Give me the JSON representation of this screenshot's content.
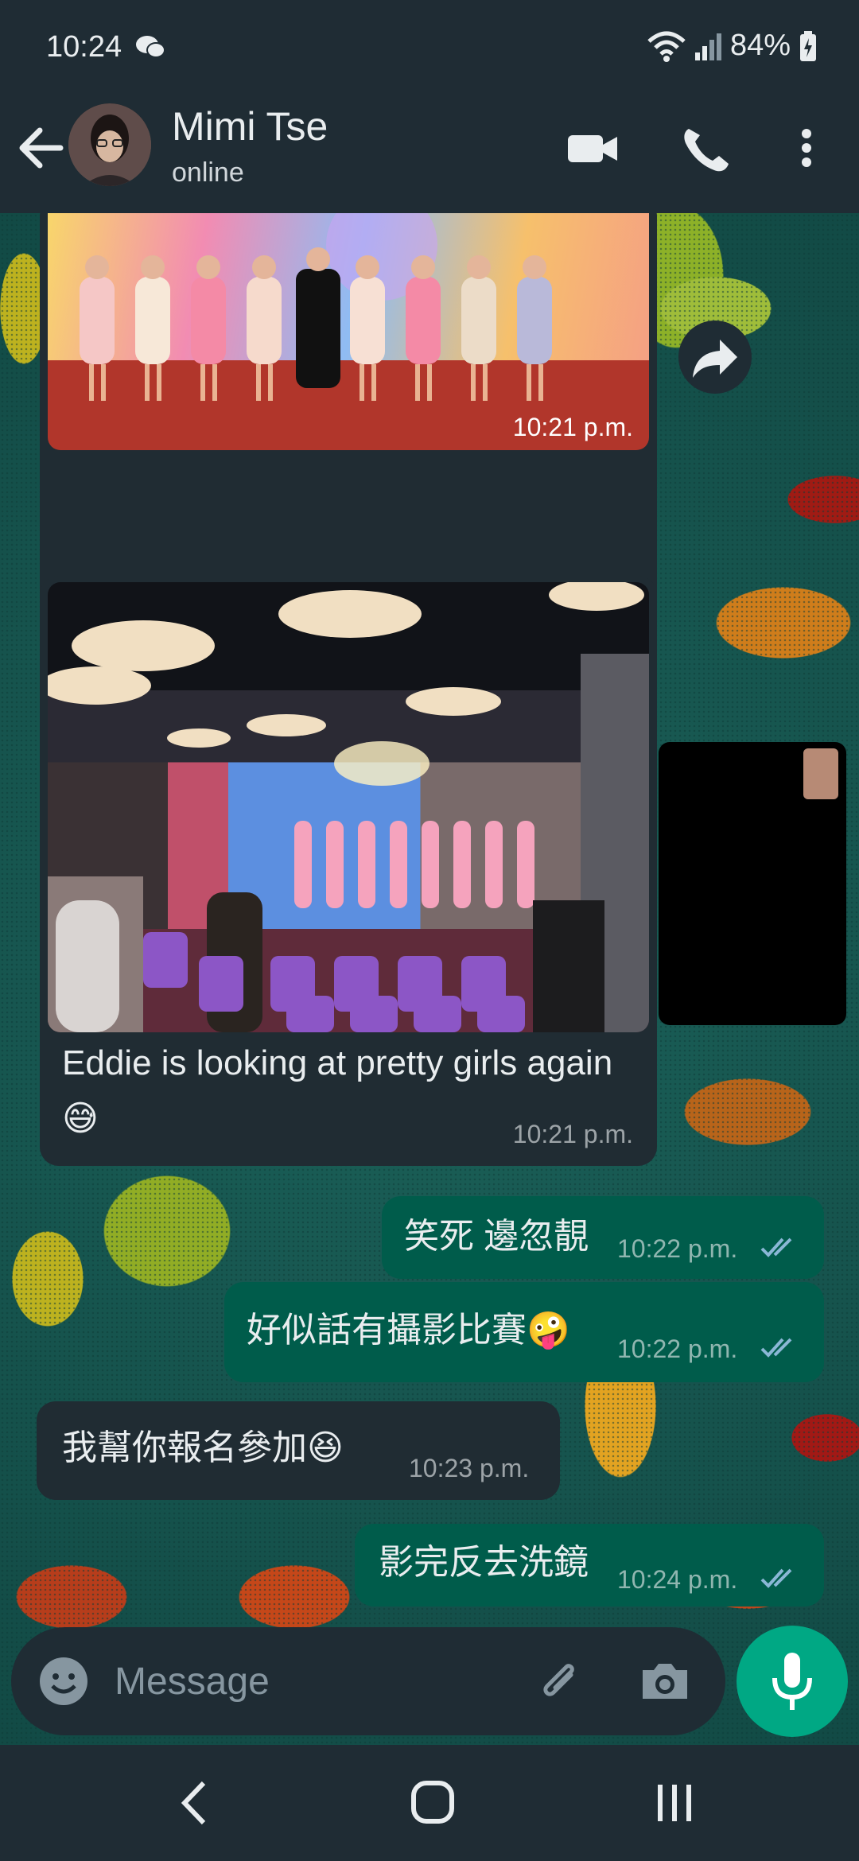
{
  "status_bar": {
    "time": "10:24",
    "battery": "84%",
    "icons": [
      "wechat-icon",
      "wifi-icon",
      "signal-icon",
      "battery-icon"
    ]
  },
  "header": {
    "name": "Mimi Tse",
    "status": "online",
    "icons": [
      "back-arrow-icon",
      "video-call-icon",
      "phone-icon",
      "more-vert-icon"
    ]
  },
  "messages": [
    {
      "id": "m1",
      "direction": "incoming",
      "type": "image",
      "time": "10:21 p.m."
    },
    {
      "id": "m2",
      "direction": "incoming",
      "type": "image",
      "text": "Eddie is looking at pretty girls again 😅",
      "time": "10:21 p.m."
    },
    {
      "id": "m3",
      "direction": "outgoing",
      "text": "笑死 邊忽靚",
      "time": "10:22 p.m.",
      "read": true
    },
    {
      "id": "m4",
      "direction": "outgoing",
      "text": "好似話有攝影比賽🤪",
      "time": "10:22 p.m.",
      "read": true
    },
    {
      "id": "m5",
      "direction": "incoming",
      "text": "我幫你報名參加😆",
      "time": "10:23 p.m."
    },
    {
      "id": "m6",
      "direction": "outgoing",
      "text": "影完反去洗鏡",
      "time": "10:24 p.m.",
      "read": true
    }
  ],
  "composer": {
    "placeholder": "Message",
    "icons": [
      "emoji-icon",
      "attach-icon",
      "camera-icon",
      "mic-icon"
    ]
  },
  "nav_bar": {
    "icons": [
      "back-nav-icon",
      "home-nav-icon",
      "recents-nav-icon"
    ]
  },
  "colors": {
    "header": "#1f2c34",
    "incoming": "#202c33",
    "outgoing": "#005c4b",
    "accent": "#00a884",
    "read_tick": "#53bdeb"
  }
}
